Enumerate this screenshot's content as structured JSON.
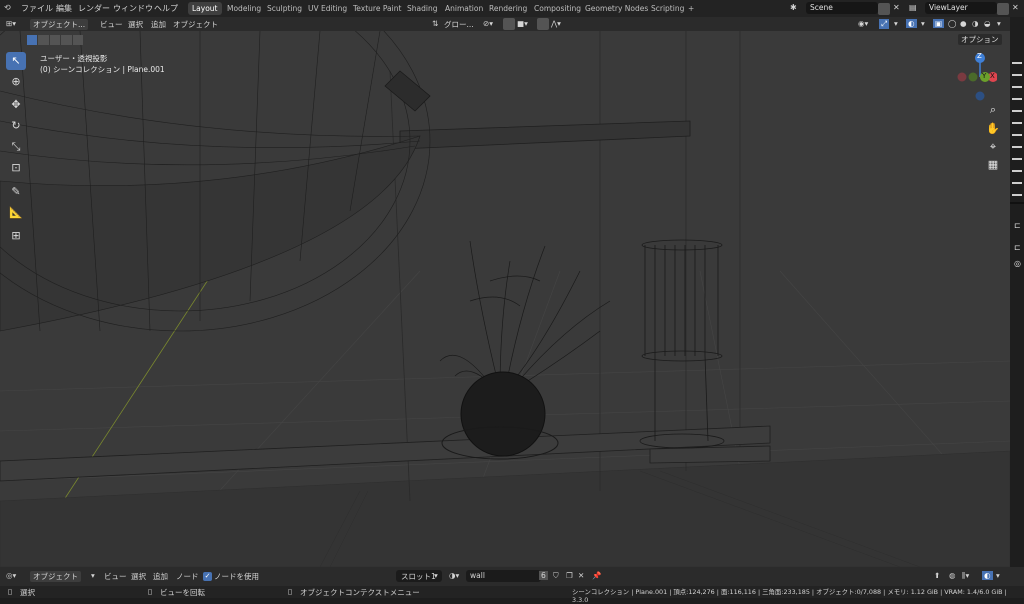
{
  "topbar": {
    "menus": [
      "ファイル",
      "編集",
      "レンダー",
      "ウィンドウ",
      "ヘルプ"
    ],
    "workspaces": [
      "Layout",
      "Modeling",
      "Sculpting",
      "UV Editing",
      "Texture Paint",
      "Shading",
      "Animation",
      "Rendering",
      "Compositing",
      "Geometry Nodes",
      "Scripting"
    ],
    "add_tab": "+",
    "scene": "Scene",
    "view_layer": "ViewLayer"
  },
  "header": {
    "mode": "オブジェクト...",
    "menus": [
      "ビュー",
      "選択",
      "追加",
      "オブジェクト"
    ],
    "orientation": "グロー...",
    "options": "オプション"
  },
  "viewport": {
    "view_name": "ユーザー・透視投影",
    "collection_info": "(0) シーンコレクション | Plane.001",
    "gizmo": {
      "z": "Z",
      "y": "Y",
      "x": "X"
    }
  },
  "bottom": {
    "mode": "オブジェクト",
    "menus": [
      "ビュー",
      "選択",
      "追加",
      "ノード"
    ],
    "use_nodes_label": "ノードを使用",
    "slot": "スロット1",
    "material": "wall",
    "users": "6"
  },
  "status": {
    "select": "選択",
    "rotate": "ビューを回転",
    "context": "オブジェクトコンテクストメニュー",
    "stats": "シーンコレクション | Plane.001 | 頂点:124,276 | 面:116,116 | 三角面:233,185 | オブジェクト:0/7,088 | メモリ: 1.12 GiB | VRAM: 1.4/6.0 GiB | 3.3.0"
  },
  "colors": {
    "accent": "#4772b3",
    "x_axis": "#e0454f",
    "y_axis": "#6ba02b",
    "z_axis": "#3f7fd6"
  }
}
